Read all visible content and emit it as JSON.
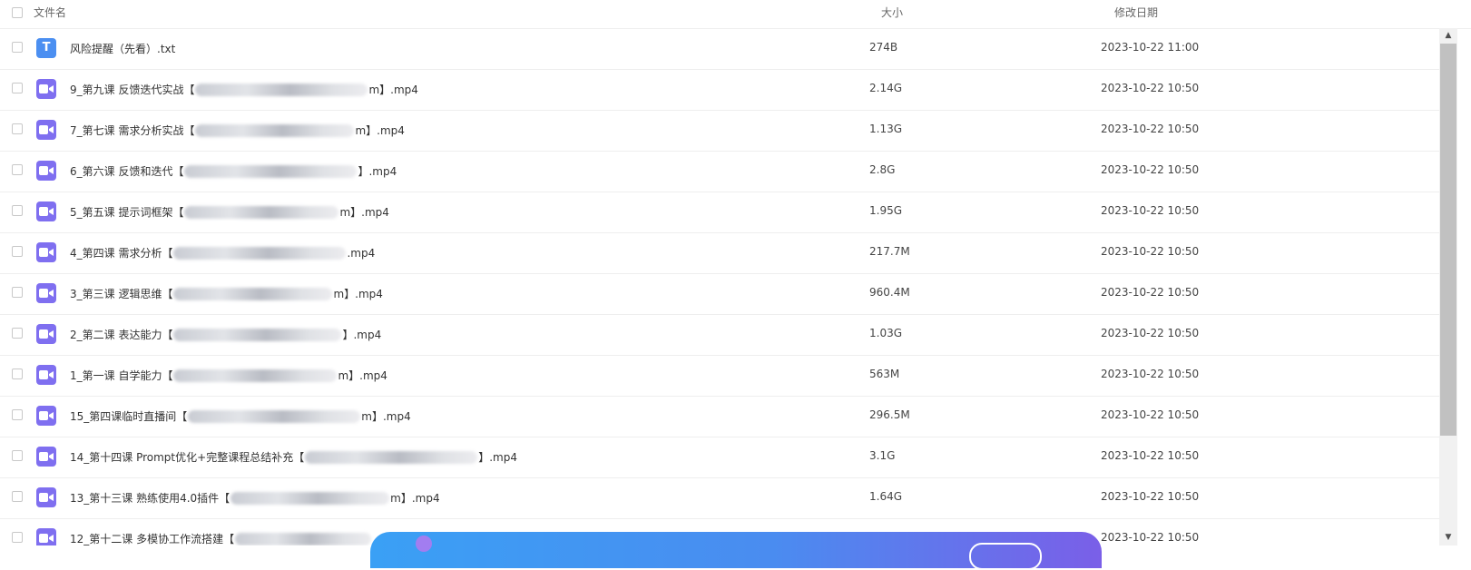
{
  "header": {
    "col_name": "文件名",
    "col_size": "大小",
    "col_date": "修改日期"
  },
  "colors": {
    "txt_icon": "#4b8ff1",
    "video_icon": "#7f6ff0",
    "banner_start": "#3aa0f5",
    "banner_end": "#7a5fe8"
  },
  "files": [
    {
      "icon": "txt-file-icon",
      "name_pre": "风险提醒（先看）.txt",
      "name_post": "",
      "size": "274B",
      "date": "2023-10-22 11:00"
    },
    {
      "icon": "video-file-icon",
      "name_pre": "9_第九课 反馈迭代实战【",
      "name_post": "m】.mp4",
      "size": "2.14G",
      "date": "2023-10-22 10:50"
    },
    {
      "icon": "video-file-icon",
      "name_pre": "7_第七课 需求分析实战【",
      "name_post": "m】.mp4",
      "size": "1.13G",
      "date": "2023-10-22 10:50"
    },
    {
      "icon": "video-file-icon",
      "name_pre": "6_第六课 反馈和迭代【",
      "name_post": "】.mp4",
      "size": "2.8G",
      "date": "2023-10-22 10:50"
    },
    {
      "icon": "video-file-icon",
      "name_pre": "5_第五课 提示词框架【",
      "name_post": "m】.mp4",
      "size": "1.95G",
      "date": "2023-10-22 10:50"
    },
    {
      "icon": "video-file-icon",
      "name_pre": "4_第四课 需求分析【",
      "name_post": ".mp4",
      "size": "217.7M",
      "date": "2023-10-22 10:50"
    },
    {
      "icon": "video-file-icon",
      "name_pre": "3_第三课 逻辑思维【",
      "name_post": "m】.mp4",
      "size": "960.4M",
      "date": "2023-10-22 10:50"
    },
    {
      "icon": "video-file-icon",
      "name_pre": "2_第二课 表达能力【",
      "name_post": "】.mp4",
      "size": "1.03G",
      "date": "2023-10-22 10:50"
    },
    {
      "icon": "video-file-icon",
      "name_pre": "1_第一课 自学能力【",
      "name_post": "m】.mp4",
      "size": "563M",
      "date": "2023-10-22 10:50"
    },
    {
      "icon": "video-file-icon",
      "name_pre": "15_第四课临时直播间【",
      "name_post": "m】.mp4",
      "size": "296.5M",
      "date": "2023-10-22 10:50"
    },
    {
      "icon": "video-file-icon",
      "name_pre": "14_第十四课 Prompt优化+完整课程总结补充【",
      "name_post": "】.mp4",
      "size": "3.1G",
      "date": "2023-10-22 10:50"
    },
    {
      "icon": "video-file-icon",
      "name_pre": "13_第十三课 熟练使用4.0插件【",
      "name_post": "m】.mp4",
      "size": "1.64G",
      "date": "2023-10-22 10:50"
    },
    {
      "icon": "video-file-icon",
      "name_pre": "12_第十二课 多模协工作流搭建【",
      "name_post": "",
      "size": "",
      "date": "2023-10-22 10:50"
    }
  ],
  "scrollbar": {
    "up_icon": "▲",
    "down_icon": "▼"
  }
}
